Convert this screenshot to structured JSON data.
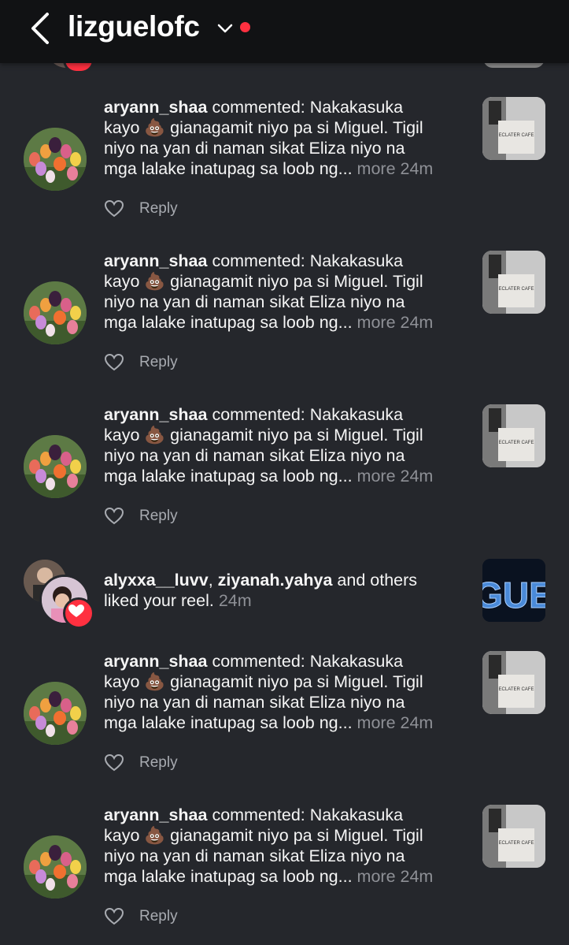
{
  "header": {
    "title": "lizguelofc"
  },
  "notifications": [
    {
      "username": "aryann_shaa",
      "line1_rest": " commented: Nakakasuka",
      "line2": "kayo 💩 gianagamit niyo pa si Miguel. Tigil",
      "line3": "niyo na yan di naman sikat Eliza niyo na",
      "line4": "mga lalake inatupag sa loob ng...",
      "more": "more",
      "time": "24m",
      "reply": "Reply"
    },
    {
      "username": "aryann_shaa",
      "line1_rest": " commented: Nakakasuka",
      "line2": "kayo 💩 gianagamit niyo pa si Miguel. Tigil",
      "line3": "niyo na yan di naman sikat Eliza niyo na",
      "line4": "mga lalake inatupag sa loob ng...",
      "more": "more",
      "time": "24m",
      "reply": "Reply"
    },
    {
      "username": "aryann_shaa",
      "line1_rest": " commented: Nakakasuka",
      "line2": "kayo 💩 gianagamit niyo pa si Miguel. Tigil",
      "line3": "niyo na yan di naman sikat Eliza niyo na",
      "line4": "mga lalake inatupag sa loob ng...",
      "more": "more",
      "time": "24m",
      "reply": "Reply"
    },
    {
      "username": "aryann_shaa",
      "line1_rest": " commented: Nakakasuka",
      "line2": "kayo 💩 gianagamit niyo pa si Miguel. Tigil",
      "line3": "niyo na yan di naman sikat Eliza niyo na",
      "line4": "mga lalake inatupag sa loob ng...",
      "more": "more",
      "time": "24m",
      "reply": "Reply"
    },
    {
      "username": "aryann_shaa",
      "line1_rest": " commented: Nakakasuka",
      "line2": "kayo 💩 gianagamit niyo pa si Miguel. Tigil",
      "line3": "niyo na yan di naman sikat Eliza niyo na",
      "line4": "mga lalake inatupag sa loob ng...",
      "more": "more",
      "time": "24m",
      "reply": "Reply"
    }
  ],
  "like_notification": {
    "user1": "alyxxa__luvv",
    "sep": ", ",
    "user2": "ziyanah.yahya",
    "rest": " and others",
    "line2": "liked your reel.",
    "time": "24m",
    "thumb_text": "GUE"
  },
  "thumb_label": "ECLATER CAFE",
  "colors": {
    "accent_red": "#ff3040",
    "background": "#25272c",
    "header": "#111214"
  },
  "icons": [
    "back-arrow-icon",
    "chevron-down-icon",
    "heart-icon",
    "like-heart-outline-icon"
  ]
}
